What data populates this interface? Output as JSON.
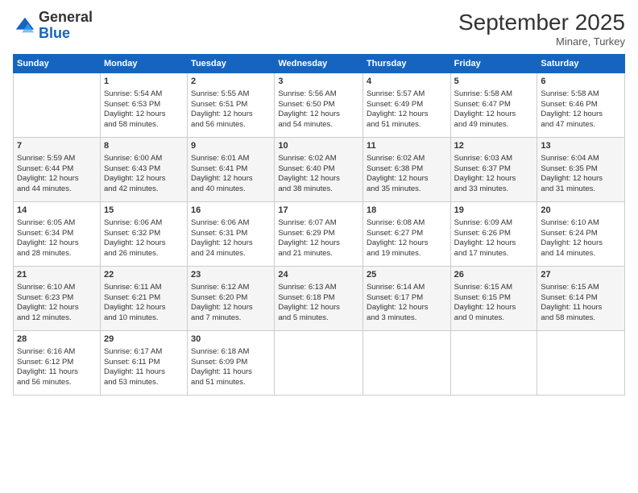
{
  "header": {
    "logo_general": "General",
    "logo_blue": "Blue",
    "month": "September 2025",
    "location": "Minare, Turkey"
  },
  "days_of_week": [
    "Sunday",
    "Monday",
    "Tuesday",
    "Wednesday",
    "Thursday",
    "Friday",
    "Saturday"
  ],
  "weeks": [
    [
      {
        "day": "",
        "info": ""
      },
      {
        "day": "1",
        "info": "Sunrise: 5:54 AM\nSunset: 6:53 PM\nDaylight: 12 hours\nand 58 minutes."
      },
      {
        "day": "2",
        "info": "Sunrise: 5:55 AM\nSunset: 6:51 PM\nDaylight: 12 hours\nand 56 minutes."
      },
      {
        "day": "3",
        "info": "Sunrise: 5:56 AM\nSunset: 6:50 PM\nDaylight: 12 hours\nand 54 minutes."
      },
      {
        "day": "4",
        "info": "Sunrise: 5:57 AM\nSunset: 6:49 PM\nDaylight: 12 hours\nand 51 minutes."
      },
      {
        "day": "5",
        "info": "Sunrise: 5:58 AM\nSunset: 6:47 PM\nDaylight: 12 hours\nand 49 minutes."
      },
      {
        "day": "6",
        "info": "Sunrise: 5:58 AM\nSunset: 6:46 PM\nDaylight: 12 hours\nand 47 minutes."
      }
    ],
    [
      {
        "day": "7",
        "info": "Sunrise: 5:59 AM\nSunset: 6:44 PM\nDaylight: 12 hours\nand 44 minutes."
      },
      {
        "day": "8",
        "info": "Sunrise: 6:00 AM\nSunset: 6:43 PM\nDaylight: 12 hours\nand 42 minutes."
      },
      {
        "day": "9",
        "info": "Sunrise: 6:01 AM\nSunset: 6:41 PM\nDaylight: 12 hours\nand 40 minutes."
      },
      {
        "day": "10",
        "info": "Sunrise: 6:02 AM\nSunset: 6:40 PM\nDaylight: 12 hours\nand 38 minutes."
      },
      {
        "day": "11",
        "info": "Sunrise: 6:02 AM\nSunset: 6:38 PM\nDaylight: 12 hours\nand 35 minutes."
      },
      {
        "day": "12",
        "info": "Sunrise: 6:03 AM\nSunset: 6:37 PM\nDaylight: 12 hours\nand 33 minutes."
      },
      {
        "day": "13",
        "info": "Sunrise: 6:04 AM\nSunset: 6:35 PM\nDaylight: 12 hours\nand 31 minutes."
      }
    ],
    [
      {
        "day": "14",
        "info": "Sunrise: 6:05 AM\nSunset: 6:34 PM\nDaylight: 12 hours\nand 28 minutes."
      },
      {
        "day": "15",
        "info": "Sunrise: 6:06 AM\nSunset: 6:32 PM\nDaylight: 12 hours\nand 26 minutes."
      },
      {
        "day": "16",
        "info": "Sunrise: 6:06 AM\nSunset: 6:31 PM\nDaylight: 12 hours\nand 24 minutes."
      },
      {
        "day": "17",
        "info": "Sunrise: 6:07 AM\nSunset: 6:29 PM\nDaylight: 12 hours\nand 21 minutes."
      },
      {
        "day": "18",
        "info": "Sunrise: 6:08 AM\nSunset: 6:27 PM\nDaylight: 12 hours\nand 19 minutes."
      },
      {
        "day": "19",
        "info": "Sunrise: 6:09 AM\nSunset: 6:26 PM\nDaylight: 12 hours\nand 17 minutes."
      },
      {
        "day": "20",
        "info": "Sunrise: 6:10 AM\nSunset: 6:24 PM\nDaylight: 12 hours\nand 14 minutes."
      }
    ],
    [
      {
        "day": "21",
        "info": "Sunrise: 6:10 AM\nSunset: 6:23 PM\nDaylight: 12 hours\nand 12 minutes."
      },
      {
        "day": "22",
        "info": "Sunrise: 6:11 AM\nSunset: 6:21 PM\nDaylight: 12 hours\nand 10 minutes."
      },
      {
        "day": "23",
        "info": "Sunrise: 6:12 AM\nSunset: 6:20 PM\nDaylight: 12 hours\nand 7 minutes."
      },
      {
        "day": "24",
        "info": "Sunrise: 6:13 AM\nSunset: 6:18 PM\nDaylight: 12 hours\nand 5 minutes."
      },
      {
        "day": "25",
        "info": "Sunrise: 6:14 AM\nSunset: 6:17 PM\nDaylight: 12 hours\nand 3 minutes."
      },
      {
        "day": "26",
        "info": "Sunrise: 6:15 AM\nSunset: 6:15 PM\nDaylight: 12 hours\nand 0 minutes."
      },
      {
        "day": "27",
        "info": "Sunrise: 6:15 AM\nSunset: 6:14 PM\nDaylight: 11 hours\nand 58 minutes."
      }
    ],
    [
      {
        "day": "28",
        "info": "Sunrise: 6:16 AM\nSunset: 6:12 PM\nDaylight: 11 hours\nand 56 minutes."
      },
      {
        "day": "29",
        "info": "Sunrise: 6:17 AM\nSunset: 6:11 PM\nDaylight: 11 hours\nand 53 minutes."
      },
      {
        "day": "30",
        "info": "Sunrise: 6:18 AM\nSunset: 6:09 PM\nDaylight: 11 hours\nand 51 minutes."
      },
      {
        "day": "",
        "info": ""
      },
      {
        "day": "",
        "info": ""
      },
      {
        "day": "",
        "info": ""
      },
      {
        "day": "",
        "info": ""
      }
    ]
  ]
}
